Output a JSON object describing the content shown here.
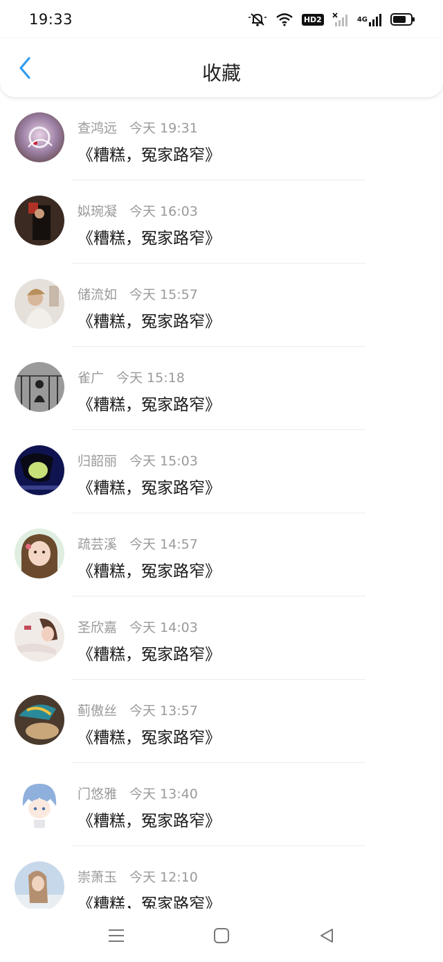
{
  "status_bar": {
    "time": "19:33",
    "icons": [
      "mute-bell-icon",
      "wifi-icon",
      "hd-icon",
      "signal-x-icon",
      "signal-4g-icon",
      "battery-icon"
    ],
    "hd_label": "HD2",
    "network_label": "4G"
  },
  "header": {
    "title": "收藏",
    "back_icon": "chevron-left-icon",
    "accent_color": "#2e9bf0"
  },
  "list": {
    "items": [
      {
        "name": "查鸿远",
        "time": "今天 19:31",
        "title": "《糟糕，冤家路窄》"
      },
      {
        "name": "姒琬凝",
        "time": "今天 16:03",
        "title": "《糟糕，冤家路窄》"
      },
      {
        "name": "储流如",
        "time": "今天 15:57",
        "title": "《糟糕，冤家路窄》"
      },
      {
        "name": "雀广",
        "time": "今天 15:18",
        "title": "《糟糕，冤家路窄》"
      },
      {
        "name": "归韶丽",
        "time": "今天 15:03",
        "title": "《糟糕，冤家路窄》"
      },
      {
        "name": "疏芸溪",
        "time": "今天 14:57",
        "title": "《糟糕，冤家路窄》"
      },
      {
        "name": "圣欣嘉",
        "time": "今天 14:03",
        "title": "《糟糕，冤家路窄》"
      },
      {
        "name": "蓟傲丝",
        "time": "今天 13:57",
        "title": "《糟糕，冤家路窄》"
      },
      {
        "name": "门悠雅",
        "time": "今天 13:40",
        "title": "《糟糕，冤家路窄》"
      },
      {
        "name": "崇萧玉",
        "time": "今天 12:10",
        "title": "《糟糕，冤家路窄》"
      }
    ]
  },
  "nav_bar": {
    "icons": [
      "menu-icon",
      "home-square-icon",
      "back-triangle-icon"
    ]
  }
}
